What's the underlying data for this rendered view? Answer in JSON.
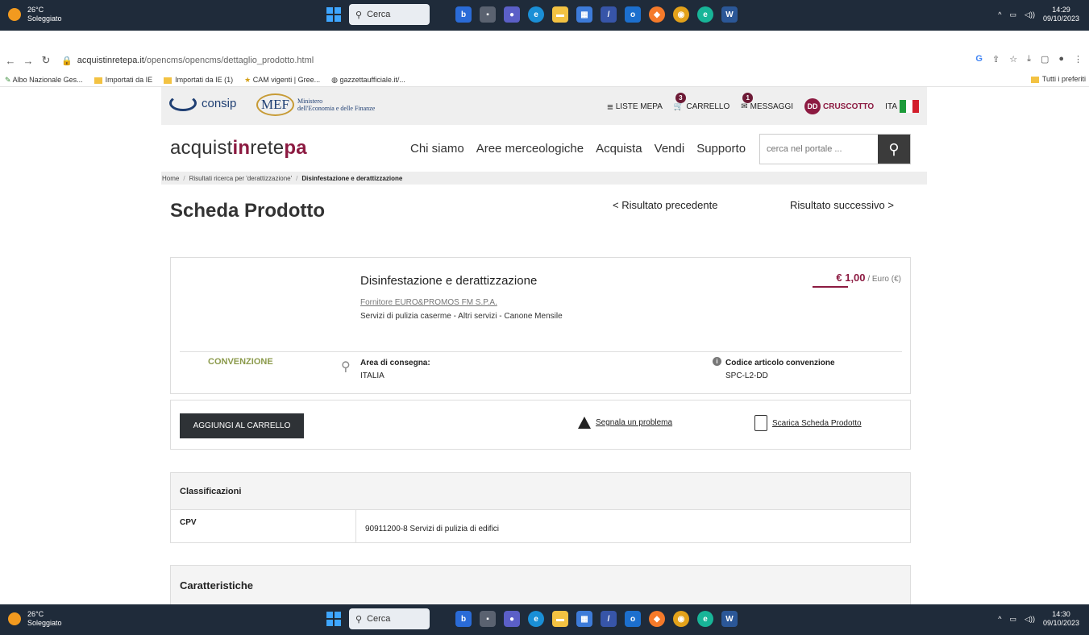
{
  "taskbar": {
    "weather_temp": "26°C",
    "weather_desc": "Soleggiato",
    "search_label": "Cerca",
    "time_top": "14:29",
    "date_top": "09/10/2023",
    "time_bottom": "14:30",
    "date_bottom": "09/10/2023",
    "apps": [
      "Bing",
      "Task view",
      "Teams",
      "Edge",
      "File Explorer",
      "Store",
      "Tasks",
      "Outlook",
      "App",
      "Chrome",
      "Edge",
      "Word"
    ],
    "app_colors": [
      "#2a6bd7",
      "#5a6270",
      "#5b5fc7",
      "#1a8fd6",
      "#f3c242",
      "#3d7bd9",
      "#3755a8",
      "#1c6fce",
      "#f57a2a",
      "#e3a21a",
      "#18b598",
      "#2b5797"
    ]
  },
  "browser": {
    "url_host": "acquistinretepa.it",
    "url_path": "/opencms/opencms/dettaglio_prodotto.html",
    "bookmarks": [
      "Albo Nazionale Ges...",
      "Importati da IE",
      "Importati da IE (1)",
      "CAM vigenti | Gree...",
      "gazzettaufficiale.it/..."
    ],
    "bookmarks_right": "Tutti i preferiti"
  },
  "gov_bar": {
    "consip": "consip",
    "mef": "MEF",
    "mef_line1": "Ministero",
    "mef_line2": "dell'Economia e delle Finanze",
    "liste_mepa": "LISTE MEPA",
    "carrello": "CARRELLO",
    "carrello_count": "3",
    "messaggi": "MESSAGGI",
    "messaggi_count": "1",
    "user_initials": "DD",
    "cruscotto": "CRUSCOTTO",
    "lang": "ITA"
  },
  "site": {
    "logo_a": "acquist",
    "logo_b": "in",
    "logo_c": "rete",
    "logo_d": "pa",
    "nav": [
      "Chi siamo",
      "Aree merceologiche",
      "Acquista",
      "Vendi",
      "Supporto"
    ],
    "search_placeholder": "cerca nel portale ..."
  },
  "breadcrumb": {
    "home": "Home",
    "results": "Risultati ricerca per 'derattizzazione'",
    "current": "Disinfestazione e derattizzazione"
  },
  "page": {
    "title": "Scheda Prodotto",
    "prev": "< Risultato precedente",
    "next": "Risultato successivo"
  },
  "product": {
    "title": "Disinfestazione e derattizzazione",
    "supplier": "Fornitore EURO&PROMOS FM S.P.A.",
    "category": "Servizi di pulizia caserme - Altri servizi - Canone Mensile",
    "price": "€ 1,00",
    "price_unit": "/ Euro (€)",
    "type": "CONVENZIONE",
    "area_label": "Area di consegna:",
    "area_value": "ITALIA",
    "code_label": "Codice articolo convenzione",
    "code_value": "SPC-L2-DD"
  },
  "actions": {
    "add_to_cart": "AGGIUNGI AL CARRELLO",
    "report": "Segnala un problema",
    "download": "Scarica Scheda Prodotto"
  },
  "classifications": {
    "header": "Classificazioni",
    "rows": [
      {
        "key": "CPV",
        "value": "90911200-8 Servizi di pulizia di edifici"
      }
    ]
  },
  "characteristics": {
    "header": "Caratteristiche"
  }
}
